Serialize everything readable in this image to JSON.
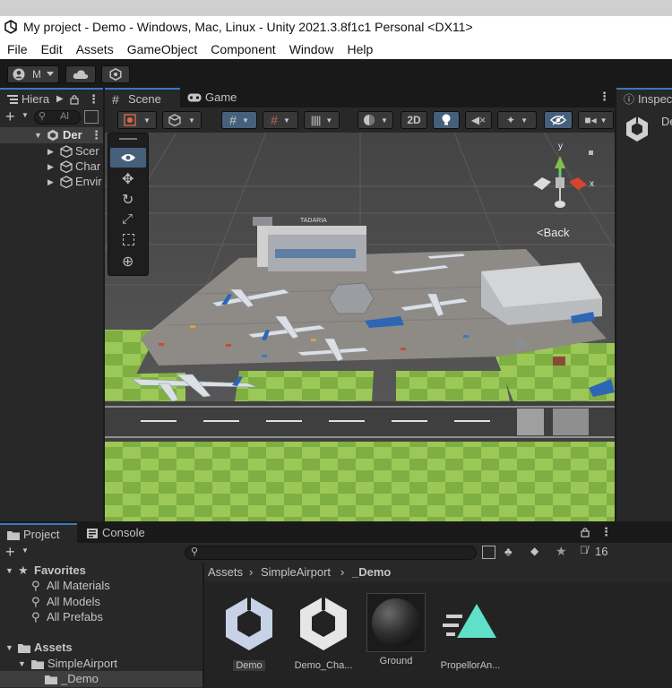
{
  "window": {
    "title": "My project - Demo - Windows, Mac, Linux - Unity 2021.3.8f1c1 Personal <DX11>"
  },
  "menu": [
    "File",
    "Edit",
    "Assets",
    "GameObject",
    "Component",
    "Window",
    "Help"
  ],
  "toolbar": {
    "account_label": "M"
  },
  "hierarchy": {
    "tab_label": "Hiera",
    "search_placeholder": "Al",
    "scene_root": "Der",
    "items": [
      "Scer",
      "Char",
      "Envir"
    ]
  },
  "scene": {
    "tabs": [
      {
        "label": "Scene"
      },
      {
        "label": "Game"
      }
    ],
    "mode_2d": "2D",
    "gizmo_y": "y",
    "gizmo_x": "x",
    "back_label": "<Back",
    "terminal_sign": "TADARIA"
  },
  "inspector": {
    "tab_label": "Inspec",
    "item_label": "De"
  },
  "project": {
    "tabs": [
      {
        "label": "Project"
      },
      {
        "label": "Console"
      }
    ],
    "hidden_count": "16",
    "favorites_label": "Favorites",
    "favorites": [
      "All Materials",
      "All Models",
      "All Prefabs"
    ],
    "assets_label": "Assets",
    "folders": [
      "SimpleAirport",
      "_Demo"
    ],
    "breadcrumb": [
      "Assets",
      "SimpleAirport",
      "_Demo"
    ],
    "assets": [
      {
        "name": "Demo",
        "icon": "unity-scene-icon"
      },
      {
        "name": "Demo_Cha...",
        "icon": "unity-scene-icon"
      },
      {
        "name": "Ground",
        "icon": "material-sphere-icon"
      },
      {
        "name": "PropellorAn...",
        "icon": "animation-clip-icon"
      }
    ]
  },
  "colors": {
    "accent": "#3a79bb",
    "panel": "#282828",
    "dark": "#191919",
    "grass": "#8cb84a"
  }
}
